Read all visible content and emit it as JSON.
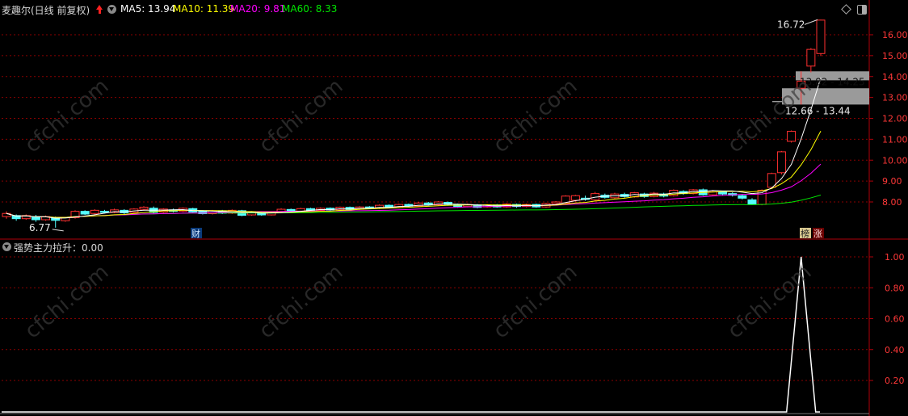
{
  "header": {
    "title": "麦趣尔(日线 前复权)",
    "ma": [
      {
        "label": "MA5: 13.94",
        "color": "#ffffff"
      },
      {
        "label": "MA10: 11.39",
        "color": "#ffff00"
      },
      {
        "label": "MA20: 9.81",
        "color": "#ff00ff"
      },
      {
        "label": "MA60: 8.33",
        "color": "#00e600"
      }
    ],
    "lower_title": "强势主力拉升：0.00"
  },
  "colors": {
    "up": "#ff3030",
    "down": "#54ffff",
    "grid": "#8b0000",
    "axis": "#b0000a",
    "tick": "#ff3838",
    "indicator": "#ffffff"
  },
  "icons": [
    "diamond-icon",
    "window-toggle-icon",
    "arrow-up-icon",
    "collapse-icon"
  ],
  "markers": {
    "cai": "财",
    "bang": "榜",
    "zhang": "涨"
  },
  "chart_data": [
    {
      "type": "candlestick",
      "title": "麦趣尔(日线 前复权)",
      "y_ticks": [
        "16.00",
        "15.00",
        "14.00",
        "13.00",
        "12.00",
        "11.00",
        "10.00",
        "9.00",
        "8.00"
      ],
      "ylim": [
        7.2,
        17.6
      ],
      "max_label": "16.72",
      "min_label": "6.77",
      "price_bands": [
        "13.82 - 14.25",
        "12.66 - 13.44"
      ],
      "candles": [
        [
          7.3,
          7.45,
          7.55,
          7.2
        ],
        [
          7.35,
          7.2,
          7.4,
          7.1
        ],
        [
          7.2,
          7.35,
          7.4,
          7.15
        ],
        [
          7.3,
          7.15,
          7.38,
          7.05
        ],
        [
          7.15,
          7.3,
          7.35,
          7.1
        ],
        [
          7.25,
          7.12,
          7.3,
          6.77
        ],
        [
          7.1,
          7.25,
          7.28,
          7.05
        ],
        [
          7.25,
          7.55,
          7.6,
          7.2
        ],
        [
          7.55,
          7.42,
          7.6,
          7.38
        ],
        [
          7.45,
          7.6,
          7.65,
          7.4
        ],
        [
          7.55,
          7.5,
          7.62,
          7.45
        ],
        [
          7.5,
          7.62,
          7.68,
          7.46
        ],
        [
          7.6,
          7.48,
          7.65,
          7.42
        ],
        [
          7.5,
          7.66,
          7.7,
          7.46
        ],
        [
          7.65,
          7.75,
          7.8,
          7.58
        ],
        [
          7.7,
          7.5,
          7.78,
          7.45
        ],
        [
          7.52,
          7.66,
          7.7,
          7.48
        ],
        [
          7.62,
          7.55,
          7.68,
          7.5
        ],
        [
          7.56,
          7.7,
          7.74,
          7.52
        ],
        [
          7.68,
          7.52,
          7.72,
          7.48
        ],
        [
          7.54,
          7.44,
          7.6,
          7.4
        ],
        [
          7.44,
          7.58,
          7.62,
          7.4
        ],
        [
          7.58,
          7.46,
          7.62,
          7.42
        ],
        [
          7.46,
          7.6,
          7.64,
          7.42
        ],
        [
          7.58,
          7.36,
          7.62,
          7.32
        ],
        [
          7.38,
          7.52,
          7.56,
          7.34
        ],
        [
          7.5,
          7.38,
          7.55,
          7.34
        ],
        [
          7.38,
          7.5,
          7.54,
          7.35
        ],
        [
          7.5,
          7.65,
          7.7,
          7.46
        ],
        [
          7.64,
          7.55,
          7.68,
          7.5
        ],
        [
          7.56,
          7.68,
          7.72,
          7.52
        ],
        [
          7.68,
          7.6,
          7.72,
          7.55
        ],
        [
          7.6,
          7.7,
          7.74,
          7.56
        ],
        [
          7.7,
          7.62,
          7.74,
          7.58
        ],
        [
          7.62,
          7.75,
          7.78,
          7.58
        ],
        [
          7.74,
          7.64,
          7.78,
          7.6
        ],
        [
          7.65,
          7.76,
          7.8,
          7.62
        ],
        [
          7.76,
          7.7,
          7.8,
          7.66
        ],
        [
          7.7,
          7.84,
          7.88,
          7.66
        ],
        [
          7.84,
          7.74,
          7.88,
          7.7
        ],
        [
          7.74,
          7.88,
          7.92,
          7.7
        ],
        [
          7.88,
          7.8,
          7.92,
          7.76
        ],
        [
          7.8,
          7.95,
          8.0,
          7.76
        ],
        [
          7.95,
          7.86,
          8.0,
          7.82
        ],
        [
          7.86,
          8.0,
          8.04,
          7.82
        ],
        [
          7.98,
          7.88,
          8.02,
          7.82
        ],
        [
          7.88,
          7.78,
          7.92,
          7.72
        ],
        [
          7.78,
          7.88,
          7.92,
          7.74
        ],
        [
          7.86,
          7.74,
          7.9,
          7.7
        ],
        [
          7.76,
          7.86,
          7.9,
          7.72
        ],
        [
          7.86,
          7.76,
          7.9,
          7.72
        ],
        [
          7.76,
          7.9,
          7.94,
          7.72
        ],
        [
          7.88,
          7.78,
          7.92,
          7.72
        ],
        [
          7.78,
          7.88,
          7.92,
          7.74
        ],
        [
          7.88,
          7.76,
          7.92,
          7.72
        ],
        [
          7.76,
          7.92,
          7.96,
          7.72
        ],
        [
          7.92,
          8.0,
          8.04,
          7.86
        ],
        [
          7.95,
          8.28,
          8.32,
          7.9
        ],
        [
          8.08,
          8.3,
          8.34,
          8.02
        ],
        [
          8.18,
          8.12,
          8.3,
          8.06
        ],
        [
          8.1,
          8.4,
          8.48,
          8.06
        ],
        [
          8.32,
          8.22,
          8.4,
          8.16
        ],
        [
          8.2,
          8.38,
          8.44,
          8.14
        ],
        [
          8.36,
          8.26,
          8.44,
          8.2
        ],
        [
          8.24,
          8.44,
          8.48,
          8.2
        ],
        [
          8.38,
          8.26,
          8.44,
          8.2
        ],
        [
          8.26,
          8.42,
          8.48,
          8.22
        ],
        [
          8.38,
          8.28,
          8.44,
          8.22
        ],
        [
          8.3,
          8.56,
          8.6,
          8.26
        ],
        [
          8.5,
          8.4,
          8.56,
          8.34
        ],
        [
          8.4,
          8.58,
          8.62,
          8.36
        ],
        [
          8.58,
          8.34,
          8.64,
          8.3
        ],
        [
          8.34,
          8.48,
          8.52,
          8.3
        ],
        [
          8.48,
          8.38,
          8.52,
          8.32
        ],
        [
          8.4,
          8.32,
          8.46,
          8.26
        ],
        [
          8.3,
          8.18,
          8.36,
          8.12
        ],
        [
          8.1,
          7.9,
          8.18,
          7.86
        ],
        [
          7.88,
          8.56,
          8.6,
          7.84
        ],
        [
          8.7,
          9.36,
          9.4,
          8.66
        ],
        [
          9.4,
          10.4,
          10.44,
          9.32
        ],
        [
          10.9,
          11.38,
          11.42,
          10.84
        ],
        [
          13.44,
          13.78,
          14.25,
          12.66
        ],
        [
          14.5,
          15.3,
          15.36,
          14.2
        ],
        [
          15.1,
          16.7,
          16.72,
          14.98
        ]
      ],
      "ma": {
        "MA5": {
          "start": 8.5,
          "end": 13.94
        },
        "MA10": {
          "start": 8.4,
          "end": 11.39
        },
        "MA20": {
          "start": 8.3,
          "end": 9.81
        },
        "MA60": {
          "start": 7.95,
          "end": 8.33
        }
      }
    },
    {
      "type": "line",
      "title": "强势主力拉升：0.00",
      "y_ticks": [
        "1.00",
        "0.80",
        "0.60",
        "0.40",
        "0.20"
      ],
      "ylim": [
        0,
        1.0
      ],
      "spike_at_candle": 81,
      "value": 0.0
    }
  ]
}
